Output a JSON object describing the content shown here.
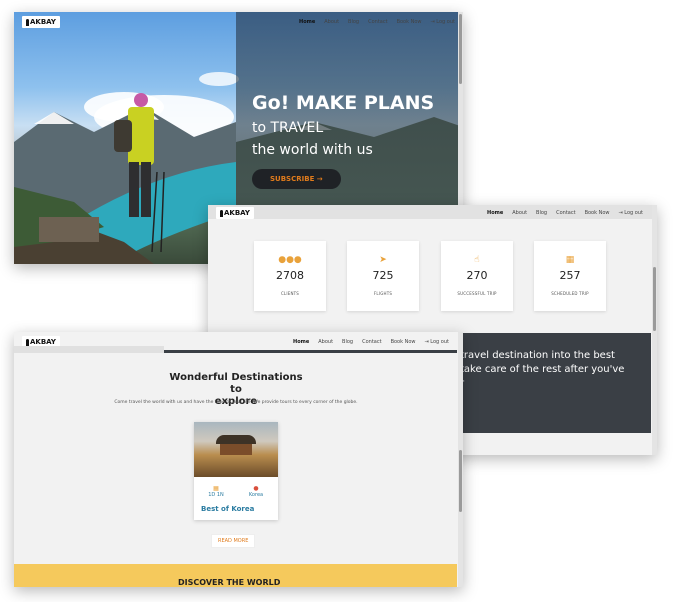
{
  "brand": {
    "logo_text": "AKBAY"
  },
  "nav": {
    "items": [
      "Home",
      "About",
      "Blog",
      "Contact",
      "Book Now",
      "Log out"
    ]
  },
  "hero": {
    "headline": "Go! MAKE PLANS",
    "subline1": "to TRAVEL",
    "subline2": "the world with us",
    "cta": "SUBSCRIBE →"
  },
  "stats": [
    {
      "icon": "users-icon",
      "value": "2708",
      "label": "CLIENTS"
    },
    {
      "icon": "paper-plane-icon",
      "value": "725",
      "label": "FLIGHTS"
    },
    {
      "icon": "thumbs-up-icon",
      "value": "270",
      "label": "SUCCESSFUL TRIP"
    },
    {
      "icon": "calendar-icon",
      "value": "257",
      "label": "SCHEDULED TRIP"
    }
  ],
  "band": {
    "line1": "travel destination into the best",
    "line2": "take care of the rest after you've",
    "line3": "r"
  },
  "destinations": {
    "title_line1": "Wonderful Destinations to",
    "title_line2": "explore",
    "description": "Come travel the world with us and have the time of your life. We provide tours to every corner of the globe.",
    "card": {
      "duration": "1D 1N",
      "location": "Korea",
      "name": "Best of Korea"
    },
    "read_more": "READ MORE"
  },
  "footer_band": {
    "text": "DISCOVER THE WORLD"
  },
  "colors": {
    "accent": "#e07b1c",
    "link": "#2b7ca1",
    "dark": "#3a3f45",
    "yellow": "#f5c95c"
  }
}
